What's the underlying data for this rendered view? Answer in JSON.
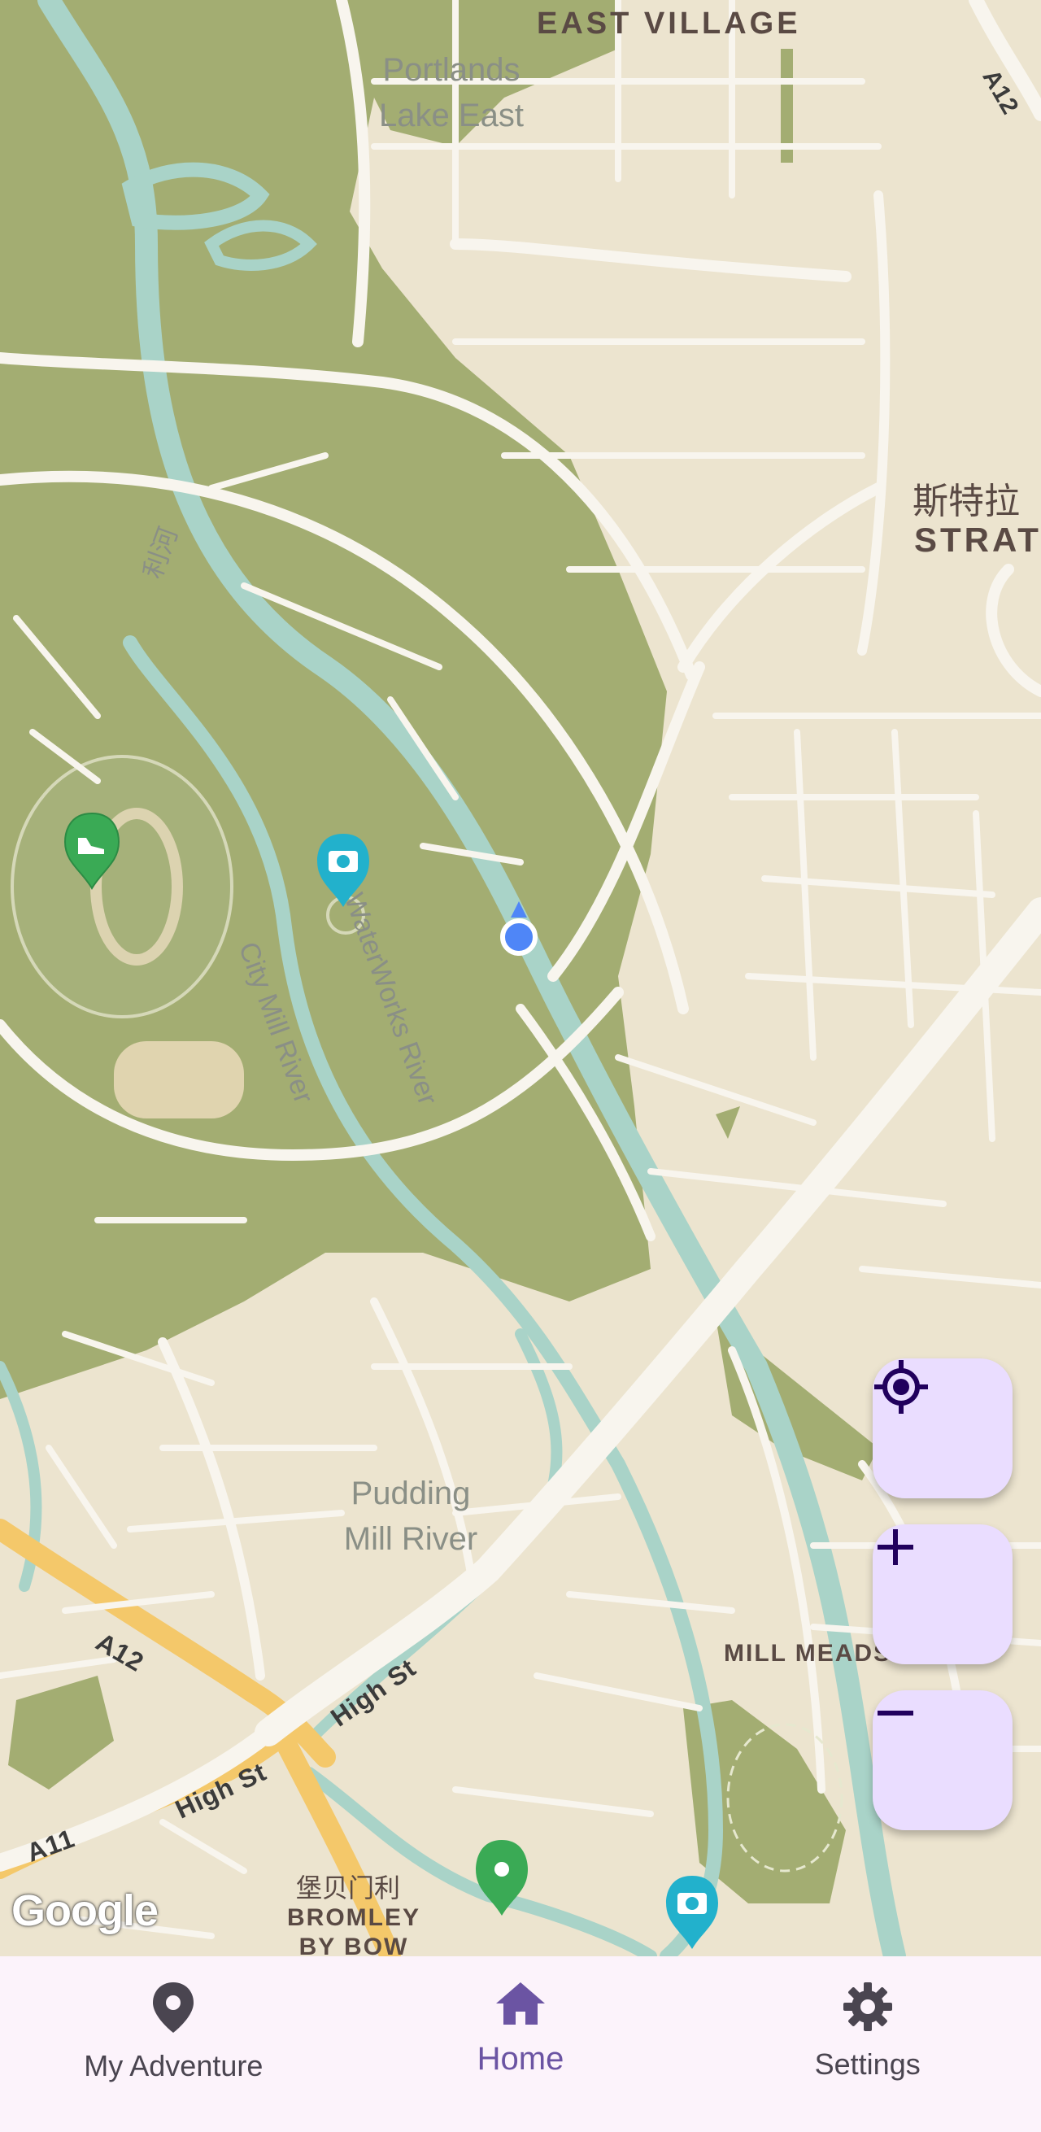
{
  "map": {
    "labels": {
      "east_village": "EAST VILLAGE",
      "portlands": "Portlands\nLake East",
      "stratford_cn": "斯特拉",
      "stratford": "STRAT",
      "waterworks_river": "WaterWorks River",
      "city_mill_river": "City Mill River",
      "cn_river_top": "利河",
      "pudding_mill": "Pudding\nMill River",
      "mill_meads": "MILL MEADS",
      "a12": "A12",
      "a12_top": "A12",
      "high_st_1": "High St",
      "high_st_2": "High St",
      "a11": "A11",
      "bromley_cn": "堡贝门利",
      "bromley": "BROMLEY\nBY BOW"
    },
    "attribution": "Google",
    "colors": {
      "park": "#a3ad72",
      "land": "#ece4cf",
      "water": "#a9d3c8",
      "road": "#f8f5ee",
      "highway": "#f4c86a",
      "location_dot": "#4f86f7",
      "marker_green": "#3aaa55",
      "marker_teal": "#22b1cc"
    },
    "markers": [
      {
        "type": "park-marker",
        "icon": "shoe-icon"
      },
      {
        "type": "photo-marker",
        "icon": "camera-icon"
      },
      {
        "type": "place-marker",
        "icon": "pin-icon"
      },
      {
        "type": "photo-marker",
        "icon": "camera-icon"
      }
    ]
  },
  "controls": {
    "locate_icon": "my-location-icon",
    "zoom_in_icon": "plus-icon",
    "zoom_out_icon": "minus-icon"
  },
  "navbar": {
    "items": [
      {
        "label": "My Adventure",
        "icon": "map-pin-icon",
        "active": false
      },
      {
        "label": "Home",
        "icon": "home-icon",
        "active": true
      },
      {
        "label": "Settings",
        "icon": "gear-icon",
        "active": false
      }
    ]
  }
}
